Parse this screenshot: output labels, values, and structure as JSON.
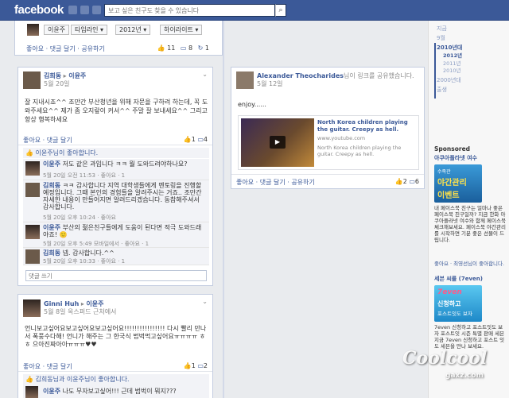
{
  "header": {
    "logo": "facebook",
    "search_placeholder": "보고 싶은 친구도 찾을 수 있습니다",
    "search_icon": "search-icon"
  },
  "profile_bar": {
    "name": "이윤주",
    "timeline": "타임라인 ▾",
    "year": "2012년 ▾",
    "highlights": "하이라이트 ▾",
    "actions": "좋아요 · 댓글 달기 · 공유하기",
    "stats": {
      "likes": "11",
      "comments": "8",
      "shares": "1"
    }
  },
  "post1": {
    "author": "김희동",
    "target": "이윤주",
    "date": "5월 20일",
    "body": "잘 지내시죠^^ 조만간 부산청년을 위해 자문을 구하려 하는데, 꼭 도와주세요^^ 제가 좀 오지랖이 커서^^ 주말 잘 보내세요^^ 그리고 항상 행복하세요",
    "actions": "좋아요 · 댓글 달기",
    "likes": "1",
    "comments": "4",
    "liked_by": "이윤주님이 좋아합니다.",
    "comments_list": [
      {
        "author": "이윤주",
        "text": "저도 같은 과입니다 ㅋㅋ 뭘 도와드려야하나요?",
        "meta": "5월 20일 오전 11:53 · 좋아요 · 1"
      },
      {
        "author": "김희동",
        "text": "ㅋㅋ 감사합니다 지역 대학생들에게 멘토링을 진행할 예정입니다. 그때 본인의 경험들을 알려주시는 거죠.. 조만간 자세한 내용이 만들어지면 알려드리겠습니다. 동참해주셔서 감사합니다.",
        "meta": "5월 20일 오후 10:24 · 좋아요"
      },
      {
        "author": "이윤주",
        "text": "부산의 젊은친구들에게 도움이 된다면 적극 도와드래야죠! 🙂",
        "meta": "5월 20일 오후 5:49 모바일에서 · 좋아요 · 1"
      },
      {
        "author": "김희동",
        "text": "넵. 감사합니다.^^",
        "meta": "5월 20일 오후 10:33 · 좋아요 · 1"
      }
    ],
    "comment_placeholder": "댓글 쓰기"
  },
  "post2": {
    "author": "Alexander Theocharides",
    "suffix": "님이 링크를 공유했습니다.",
    "date": "5월 12일",
    "body": "enjoy......",
    "link_title": "North Korea children playing the guitar. Creepy as hell.",
    "link_domain": "www.youtube.com",
    "link_desc": "North Korea children playing the guitar. Creepy as hell.",
    "actions": "좋아요 · 댓글 달기 · 공유하기",
    "likes": "2",
    "comments": "6"
  },
  "post3": {
    "author": "Ginni Huh",
    "target": "이윤주",
    "date": "5월 8일 옥스퍼드 근처에서",
    "body": "언니보고싶어요보고싶어요보고싶어요!!!!!!!!!!!!!!!! 다시 빨리 만나서 폭풍수다해! 언니가 해주는 그 한국식 법벅먹고싶어요ㅠㅠㅠㅠ ㅎㅎ 으아진짜아아ㅠㅠㅠ♥♥",
    "actions": "좋아요 · 댓글 달기",
    "likes": "1",
    "comments": "2",
    "liked_by": "김희동님과 이윤주님이 좋아합니다.",
    "comment": {
      "author": "이윤주",
      "text": "나도 무자보고싶어!!! 근데 범벅이 뭐지???"
    }
  },
  "sidebar": {
    "years": [
      "지금",
      "9월",
      "2010년대",
      "2012년",
      "2011년",
      "2010년",
      "2000년대",
      "출생"
    ],
    "sponsored": "Sponsored",
    "ad1": {
      "title": "아쿠아플라넷 여수",
      "img_text1": "수족관",
      "img_text2": "야간관리",
      "img_text3": "이벤트",
      "body": "내 페이스북 친구는 얼마나 좋은 페이스북 친구일까? 지금 한화 아쿠아플라넷 여수와 함께 페이스북 체크해보세요. 페이스북 야간관리를 시작하면 기분 좋은 선물이 드립니다.",
      "meta": "좋아요 · 최영선님이 좋아합니다."
    },
    "ad2": {
      "title": "세븐 씨를 (7even)",
      "img_text1": "7even",
      "img_text2": "신청하고",
      "img_text3": "포스트잇도 보자",
      "body": "7even 신청하고 포스트잇도 보자 포스트잇 시즌 특별 판매 세븐 지금 7even 신청하고 포스트 잇도 세븐을 만나 보세요.",
      "meta": "좋아요"
    }
  },
  "watermark": {
    "text": "Coolcool",
    "domain": "gaxz.com"
  }
}
